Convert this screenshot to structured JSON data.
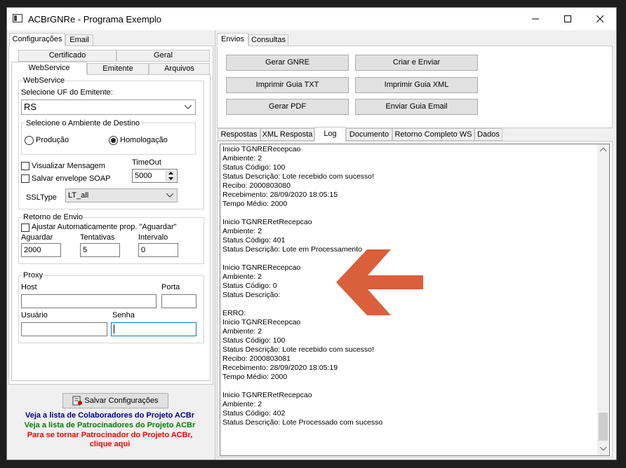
{
  "window": {
    "title": "ACBrGNRe - Programa Exemplo"
  },
  "left": {
    "top_tabs": [
      "Configurações",
      "Email"
    ],
    "tabs_row1": [
      "Certificado",
      "Geral"
    ],
    "tabs_row2": [
      "WebService",
      "Emitente",
      "Arquivos"
    ],
    "webservice": {
      "group_label": "WebService",
      "uf_label": "Selecione UF do Emitente:",
      "uf_value": "RS",
      "ambiente_label": "Selecione o Ambiente de Destino",
      "radio_producao": "Produção",
      "radio_homologacao": "Homologação",
      "chk_visualizar": "Visualizar Mensagem",
      "chk_salvar": "Salvar envelope SOAP",
      "timeout_label": "TimeOut",
      "timeout_value": "5000",
      "ssltype_label": "SSLType",
      "ssltype_value": "LT_all"
    },
    "retorno": {
      "group_label": "Retorno de Envio",
      "chk_ajustar": "Ajustar Automaticamente prop. \"Aguardar\"",
      "aguardar_label": "Aguardar",
      "aguardar_value": "2000",
      "tentativas_label": "Tentativas",
      "tentativas_value": "5",
      "intervalo_label": "Intervalo",
      "intervalo_value": "0"
    },
    "proxy": {
      "group_label": "Proxy",
      "host_label": "Host",
      "porta_label": "Porta",
      "usuario_label": "Usuário",
      "senha_label": "Senha"
    },
    "save_button": "Salvar Configurações",
    "links": {
      "colaboradores": "Veja a lista de Colaboradores do Projeto ACBr",
      "patrocinadores": "Veja a lista de Patrocinadores do Projeto ACBr",
      "patrocinador_1": "Para se tornar Patrocinador do Projeto ACBr,",
      "patrocinador_2": "clique aqui",
      "color_blue": "#00007f",
      "color_green": "#008000",
      "color_red": "#ff0000"
    }
  },
  "right": {
    "top_tabs": [
      "Envios",
      "Consultas"
    ],
    "buttons": {
      "gerar_gnre": "Gerar GNRE",
      "criar_enviar": "Criar e Enviar",
      "imprimir_txt": "Imprimir Guia TXT",
      "imprimir_xml": "Imprimir Guia XML",
      "gerar_pdf": "Gerar PDF",
      "enviar_email": "Enviar Guia Email"
    },
    "result_tabs": [
      "Respostas",
      "XML Resposta",
      "Log",
      "Documento",
      "Retorno Completo WS",
      "Dados"
    ],
    "log_lines": [
      "Inicio TGNRERecepcao",
      "Ambiente: 2",
      "Status Código: 100",
      "Status Descrição: Lote recebido com sucesso!",
      "Recibo: 2000803080",
      "Recebimento: 28/09/2020 18:05:15",
      "Tempo Médio: 2000",
      "",
      "Inicio TGNRERetRecepcao",
      "Ambiente: 2",
      "Status Código: 401",
      "Status Descrição: Lote em Processamento",
      "",
      "Inicio TGNRERecepcao",
      "Ambiente: 2",
      "Status Código: 0",
      "Status Descrição:",
      "",
      "ERRO:",
      "Inicio TGNRERecepcao",
      "Ambiente: 2",
      "Status Código: 100",
      "Status Descrição: Lote recebido com sucesso!",
      "Recibo: 2000803081",
      "Recebimento: 28/09/2020 18:05:19",
      "Tempo Médio: 2000",
      "",
      "Inicio TGNRERetRecepcao",
      "Ambiente: 2",
      "Status Código: 402",
      "Status Descrição: Lote Processado com sucesso"
    ],
    "arrow_color": "#d9603b"
  }
}
